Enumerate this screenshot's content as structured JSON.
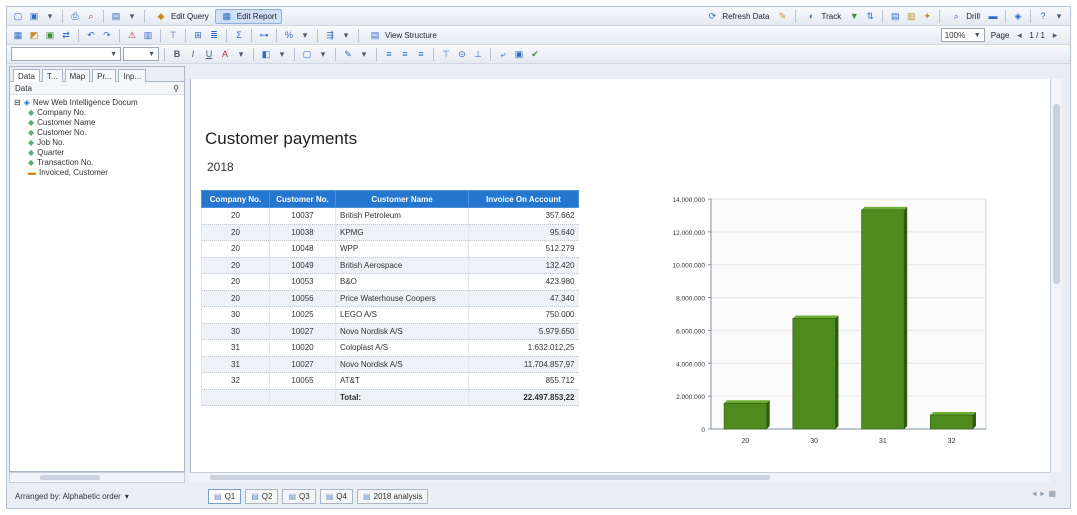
{
  "toolbar1": {
    "edit_query": "Edit Query",
    "edit_report": "Edit Report",
    "refresh": "Refresh Data",
    "track": "Track",
    "drill": "Drill"
  },
  "toolbar2": {
    "view_structure": "View Structure",
    "zoom": "100%",
    "page_label": "Page",
    "page_value": "1 / 1"
  },
  "left_panel": {
    "tabs": [
      "Data",
      "T...",
      "Map",
      "Pr...",
      "Inp..."
    ],
    "header": "Data",
    "root": "New Web Intelligence Docum",
    "objects": [
      "Company No.",
      "Customer Name",
      "Customer No.",
      "Job No.",
      "Quarter",
      "Transaction No."
    ],
    "measure": "Invoiced, Customer",
    "arranged_by": "Arranged by: Alphabetic order"
  },
  "report": {
    "title": "Customer payments",
    "year": "2018",
    "columns": [
      "Company No.",
      "Customer No.",
      "Customer Name",
      "Invoice On Account"
    ],
    "rows": [
      [
        "20",
        "10037",
        "British Petroleum",
        "357.662"
      ],
      [
        "20",
        "10038",
        "KPMG",
        "95.640"
      ],
      [
        "20",
        "10048",
        "WPP",
        "512.279"
      ],
      [
        "20",
        "10049",
        "British Aerospace",
        "132.420"
      ],
      [
        "20",
        "10053",
        "B&O",
        "423.980"
      ],
      [
        "20",
        "10056",
        "Price Waterhouse Coopers",
        "47.340"
      ],
      [
        "30",
        "10025",
        "LEGO A/S",
        "750.000"
      ],
      [
        "30",
        "10027",
        "Novo Nordisk A/S",
        "5.979.650"
      ],
      [
        "31",
        "10020",
        "Coloplast A/S",
        "1.632.012,25"
      ],
      [
        "31",
        "10027",
        "Novo Nordisk A/S",
        "11.704.857,97"
      ],
      [
        "32",
        "10055",
        "AT&T",
        "855.712"
      ],
      [
        "",
        "",
        "Total:",
        "22.497.853,22"
      ]
    ]
  },
  "chart_data": {
    "type": "bar",
    "categories": [
      "20",
      "30",
      "31",
      "32"
    ],
    "values": [
      1569321,
      6729650,
      13336870,
      855712
    ],
    "ylim": [
      0,
      14000000
    ],
    "yticks": [
      0,
      2000000,
      4000000,
      6000000,
      8000000,
      10000000,
      12000000,
      14000000
    ],
    "ytick_labels": [
      "0",
      "2.000.000",
      "4.000.000",
      "6.000.000",
      "8.000.000",
      "10.000.000",
      "12.000.000",
      "14.000.000"
    ],
    "title": "",
    "xlabel": "",
    "ylabel": "",
    "grid": true,
    "bar_color": "#4f8a1e"
  },
  "report_tabs": [
    "Q1",
    "Q2",
    "Q3",
    "Q4",
    "2018 analysis"
  ],
  "colors": {
    "accent": "#2476cf",
    "bar": "#4f8a1e"
  }
}
